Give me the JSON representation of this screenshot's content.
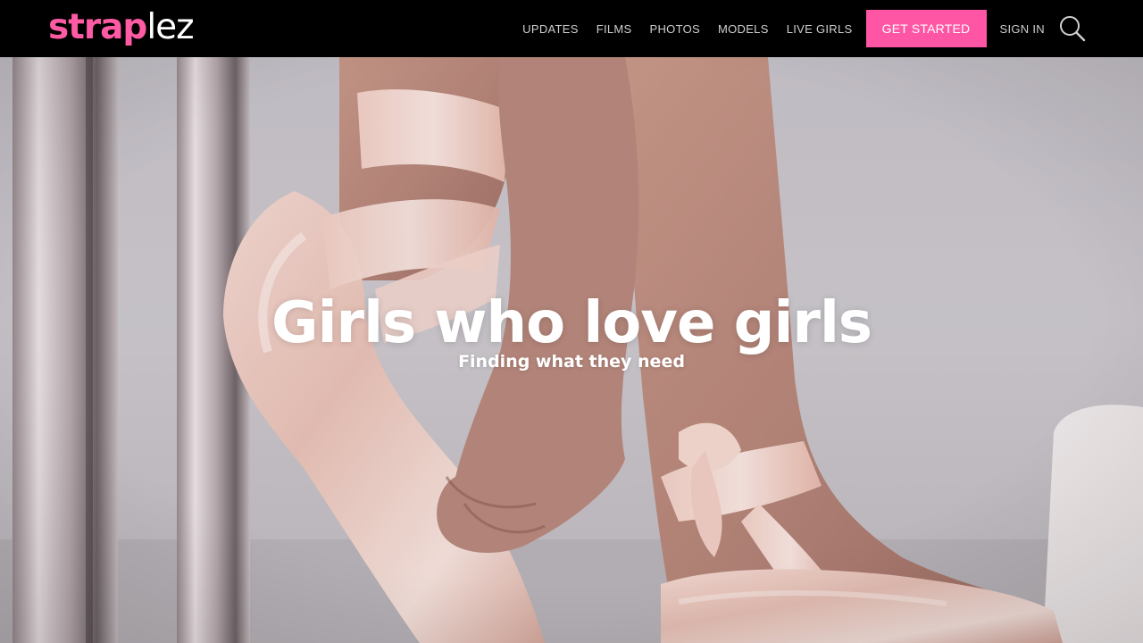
{
  "brand": {
    "logo_part_a": "strap",
    "logo_part_b": "lez",
    "accent_color": "#ff55a5"
  },
  "nav": {
    "items": [
      {
        "label": "UPDATES"
      },
      {
        "label": "FILMS"
      },
      {
        "label": "PHOTOS"
      },
      {
        "label": "MODELS"
      },
      {
        "label": "LIVE GIRLS"
      }
    ],
    "cta_label": "GET STARTED",
    "signin_label": "SIGN IN",
    "search_icon": "search-icon"
  },
  "hero": {
    "title": "Girls who love girls",
    "subtitle": "Finding what they need",
    "background_image": "photo of feet in pink satin pointe shoes being laced"
  }
}
